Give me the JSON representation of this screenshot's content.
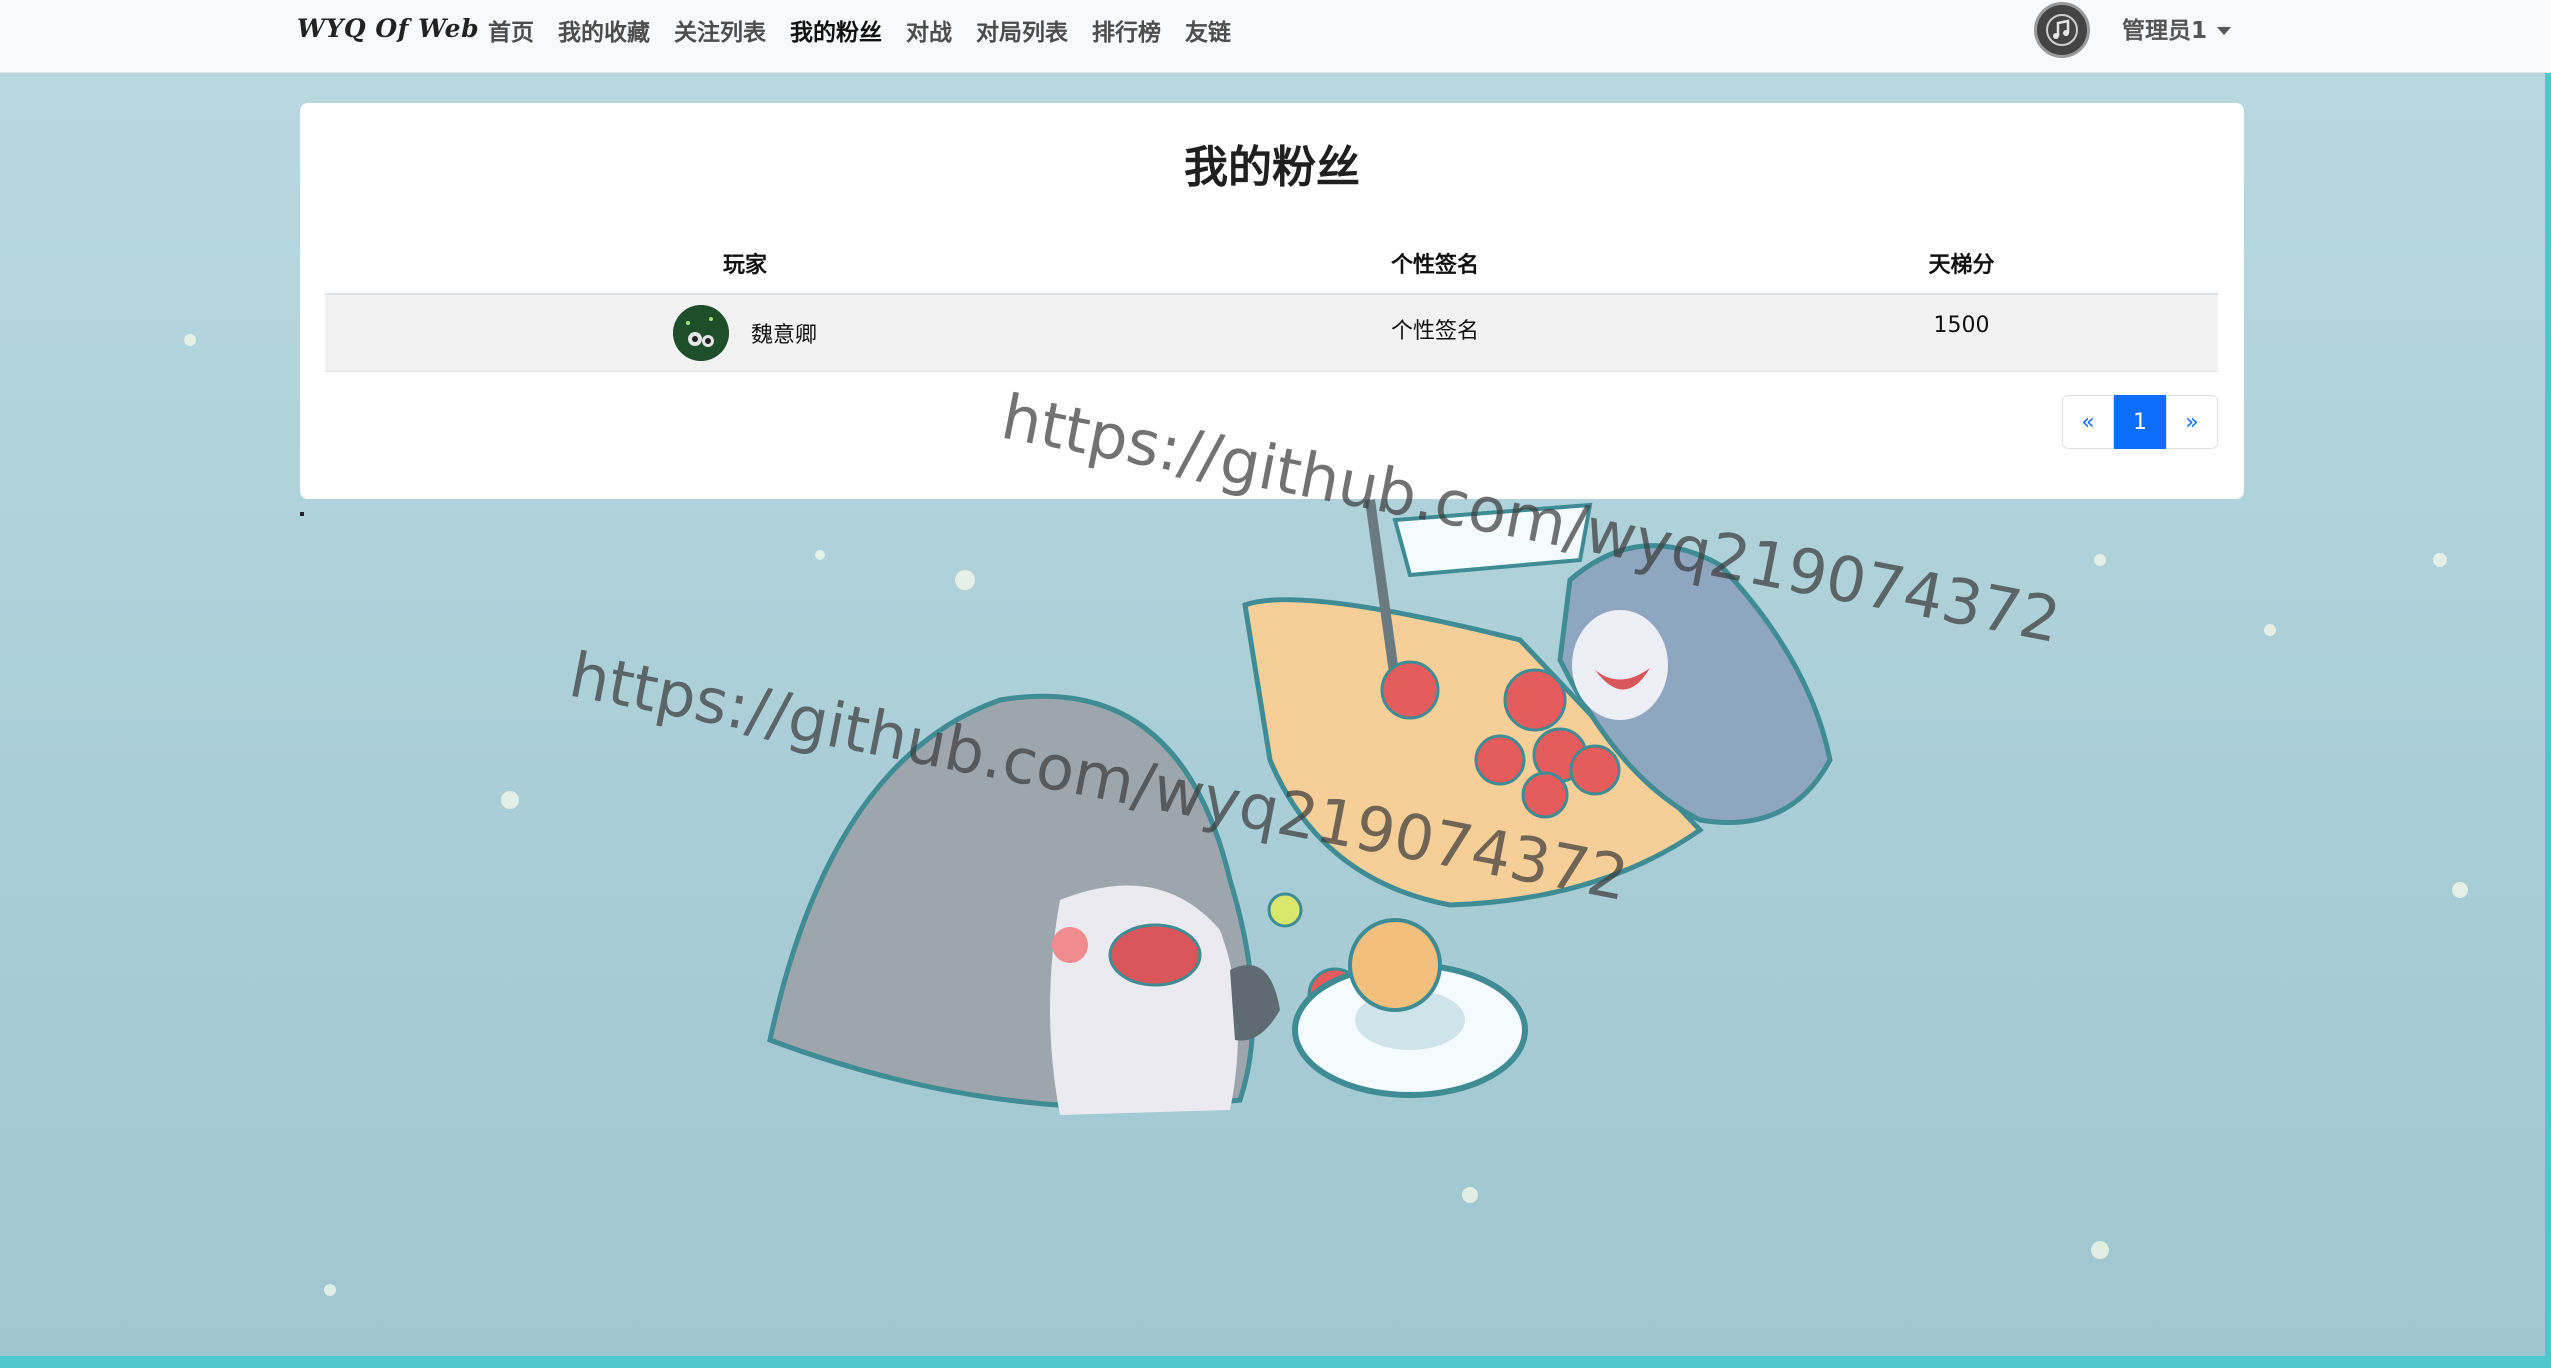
{
  "navbar": {
    "brand": "WYQ Of Web",
    "links": [
      {
        "label": "首页"
      },
      {
        "label": "我的收藏"
      },
      {
        "label": "关注列表"
      },
      {
        "label": "我的粉丝"
      },
      {
        "label": "对战"
      },
      {
        "label": "对局列表"
      },
      {
        "label": "排行榜"
      },
      {
        "label": "友链"
      }
    ],
    "active_link": "我的粉丝",
    "user_name": "管理员1"
  },
  "page": {
    "title": "我的粉丝",
    "dot": "."
  },
  "table": {
    "columns": [
      "玩家",
      "个性签名",
      "天梯分"
    ],
    "rows": [
      {
        "player": "魏意卿",
        "signature": "个性签名",
        "rating": "1500"
      }
    ]
  },
  "pagination": {
    "prev": "«",
    "current": "1",
    "next": "»"
  },
  "watermarks": [
    "https://github.com/wyq219074372",
    "https://github.com/wyq219074372"
  ],
  "colors": {
    "accent": "#0d6efd",
    "navbar_bg": "#f8f9fa",
    "card_bg": "#ffffff",
    "water": "#a9cdd7"
  },
  "icons": {
    "nav_avatar": "music-note-avatar-icon",
    "dropdown": "caret-down-icon"
  }
}
